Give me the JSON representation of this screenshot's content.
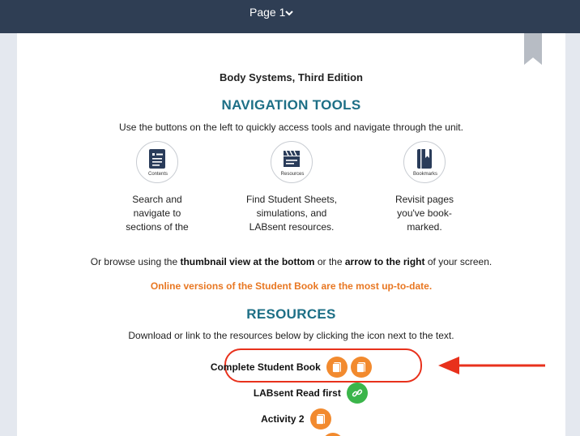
{
  "header": {
    "page_label": "Page 1"
  },
  "content": {
    "book_title": "Body Systems, Third Edition",
    "nav_heading": "NAVIGATION TOOLS",
    "nav_intro": "Use the buttons on the left to quickly access tools and navigate through the unit.",
    "tools": [
      {
        "caption": "Contents",
        "desc_l1": "Search and",
        "desc_l2": "navigate to",
        "desc_l3": "sections of the",
        "icon": "contents-icon"
      },
      {
        "caption": "Resources",
        "desc_l1": "Find Student Sheets,",
        "desc_l2": "simulations, and",
        "desc_l3": "LABsent resources.",
        "icon": "resources-icon"
      },
      {
        "caption": "Bookmarks",
        "desc_l1": "Revisit pages",
        "desc_l2": "you've book-",
        "desc_l3": "marked.",
        "icon": "bookmarks-icon"
      }
    ],
    "browse": {
      "part1": "Or browse using the ",
      "bold1": "thumbnail view at the bottom",
      "part2": " or the ",
      "bold2": "arrow to the right",
      "part3": " of your screen."
    },
    "note": "Online versions of the Student Book are the most up-to-date.",
    "resources_heading": "RESOURCES",
    "resources_intro": "Download or link to the resources below by clicking the icon next to the text.",
    "resources": [
      {
        "label": "Complete Student Book",
        "icons": [
          "document-icon",
          "document-icon"
        ]
      },
      {
        "label": "LABsent Read first",
        "icons": [
          "link-icon"
        ]
      },
      {
        "label": "Activity 2",
        "icons": [
          "document-icon"
        ]
      }
    ]
  },
  "colors": {
    "topbar": "#2f3e54",
    "heading_teal": "#1d6f86",
    "note_orange": "#e87722",
    "icon_orange": "#f28a2e",
    "icon_green": "#3bb54a",
    "annotation_red": "#e8311c"
  }
}
